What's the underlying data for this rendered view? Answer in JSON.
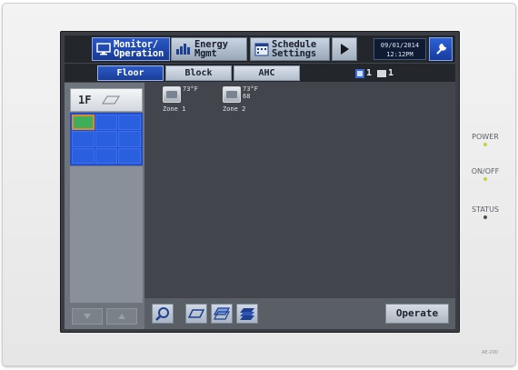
{
  "header": {
    "monitor_label": "Monitor/\nOperation",
    "energy_label": "Energy\nMgmt",
    "schedule_label": "Schedule\nSettings",
    "date": "09/01/2014",
    "time": "12:12PM"
  },
  "tabs": [
    {
      "label": "Floor",
      "active": true
    },
    {
      "label": "Block",
      "active": false
    },
    {
      "label": "AHC",
      "active": false
    }
  ],
  "counters": {
    "group_count": "1",
    "unit_count": "1"
  },
  "sidebar": {
    "floor_label": "1F"
  },
  "zones": [
    {
      "name": "Zone 1",
      "temp": "73°F",
      "extra": ""
    },
    {
      "name": "Zone 2",
      "temp": "73°F",
      "extra": "68"
    }
  ],
  "actions": {
    "operate_label": "Operate"
  },
  "indicators": [
    {
      "label": "POWER",
      "color": "#c8d23a"
    },
    {
      "label": "ON/OFF",
      "color": "#c8d23a"
    },
    {
      "label": "STATUS",
      "color": "#4a4f55"
    }
  ],
  "device": {
    "model": "AE-200"
  },
  "colors": {
    "accent": "#2a58c6",
    "screen_bg": "#43474d"
  }
}
